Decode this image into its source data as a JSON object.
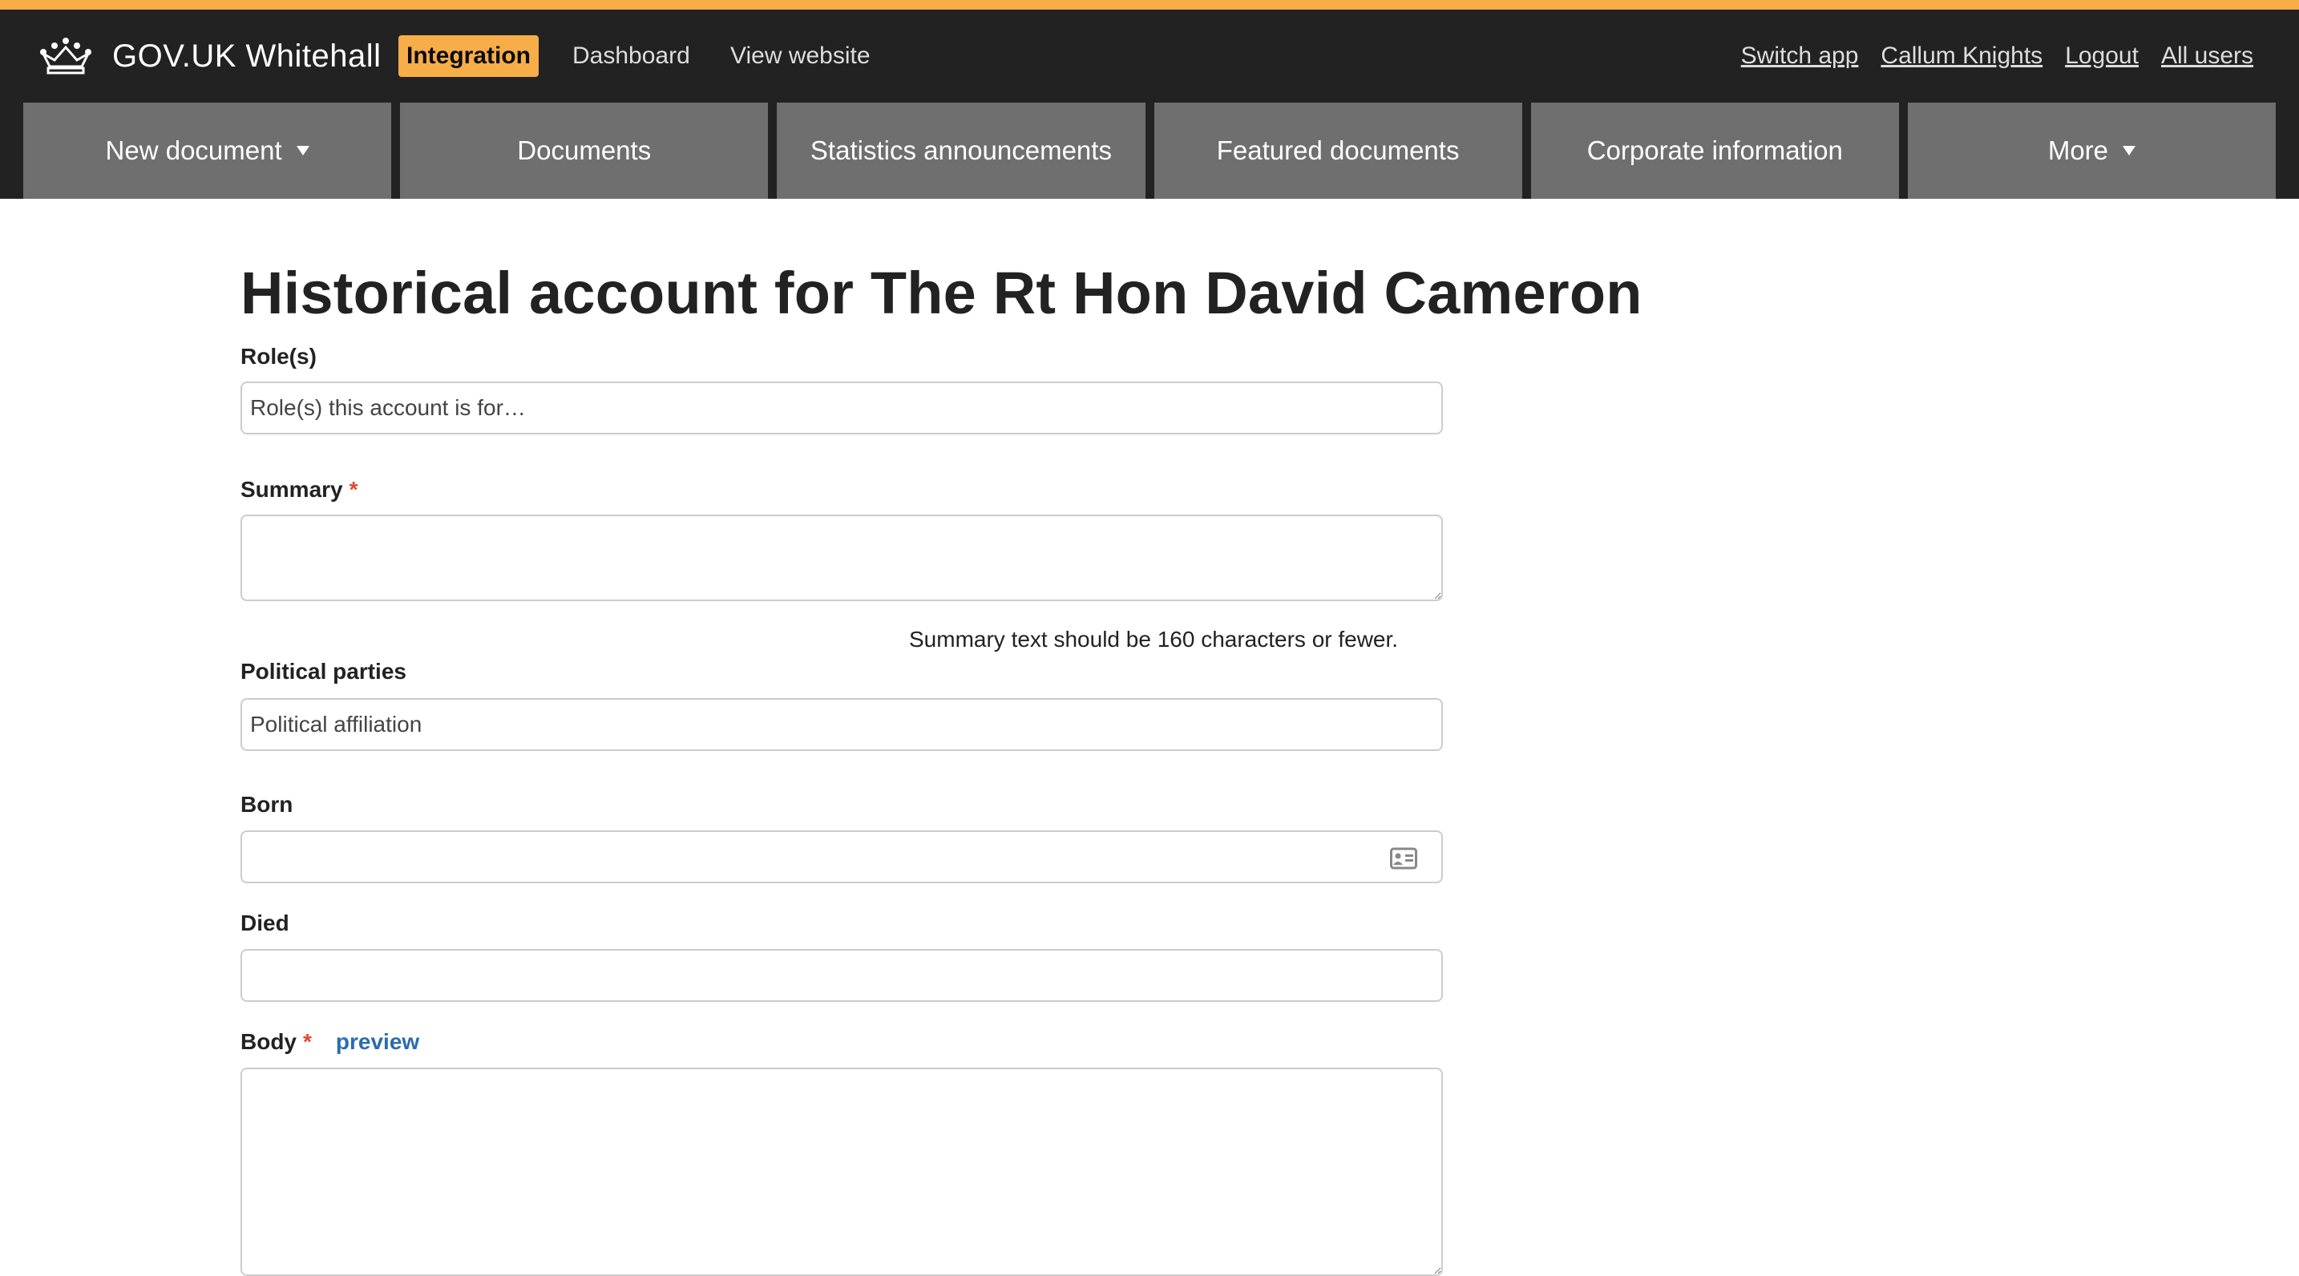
{
  "header": {
    "brand_title": "GOV.UK Whitehall",
    "environment_badge": "Integration",
    "links": {
      "dashboard": "Dashboard",
      "view_website": "View website"
    },
    "user_links": {
      "switch_app": "Switch app",
      "user_name": "Callum Knights",
      "logout": "Logout",
      "all_users": "All users"
    },
    "colors": {
      "stripe": "#f7ad48",
      "background": "#222222",
      "nav_item": "#6f6f6f"
    }
  },
  "nav": {
    "items": [
      {
        "label": "New document",
        "has_dropdown": true
      },
      {
        "label": "Documents",
        "has_dropdown": false
      },
      {
        "label": "Statistics announcements",
        "has_dropdown": false
      },
      {
        "label": "Featured documents",
        "has_dropdown": false
      },
      {
        "label": "Corporate information",
        "has_dropdown": false
      },
      {
        "label": "More",
        "has_dropdown": true
      }
    ]
  },
  "form": {
    "page_title": "Historical account for The Rt Hon David Cameron",
    "roles": {
      "label": "Role(s)",
      "placeholder": "Role(s) this account is for…",
      "value": ""
    },
    "summary": {
      "label": "Summary",
      "required_marker": "*",
      "value": "",
      "hint": "Summary text should be 160 characters or fewer."
    },
    "political_parties": {
      "label": "Political parties",
      "placeholder": "Political affiliation",
      "value": ""
    },
    "born": {
      "label": "Born",
      "value": "",
      "icon": "calendar-card-icon"
    },
    "died": {
      "label": "Died",
      "value": ""
    },
    "body": {
      "label": "Body",
      "required_marker": "*",
      "preview_link": "preview",
      "value": ""
    }
  }
}
